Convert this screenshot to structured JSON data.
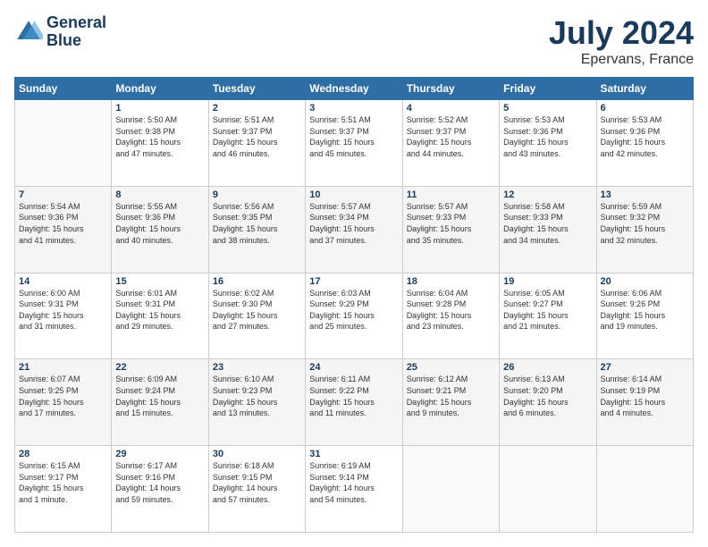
{
  "logo": {
    "line1": "General",
    "line2": "Blue"
  },
  "title": "July 2024",
  "subtitle": "Epervans, France",
  "header_days": [
    "Sunday",
    "Monday",
    "Tuesday",
    "Wednesday",
    "Thursday",
    "Friday",
    "Saturday"
  ],
  "weeks": [
    [
      {
        "day": "",
        "info": ""
      },
      {
        "day": "1",
        "info": "Sunrise: 5:50 AM\nSunset: 9:38 PM\nDaylight: 15 hours\nand 47 minutes."
      },
      {
        "day": "2",
        "info": "Sunrise: 5:51 AM\nSunset: 9:37 PM\nDaylight: 15 hours\nand 46 minutes."
      },
      {
        "day": "3",
        "info": "Sunrise: 5:51 AM\nSunset: 9:37 PM\nDaylight: 15 hours\nand 45 minutes."
      },
      {
        "day": "4",
        "info": "Sunrise: 5:52 AM\nSunset: 9:37 PM\nDaylight: 15 hours\nand 44 minutes."
      },
      {
        "day": "5",
        "info": "Sunrise: 5:53 AM\nSunset: 9:36 PM\nDaylight: 15 hours\nand 43 minutes."
      },
      {
        "day": "6",
        "info": "Sunrise: 5:53 AM\nSunset: 9:36 PM\nDaylight: 15 hours\nand 42 minutes."
      }
    ],
    [
      {
        "day": "7",
        "info": "Sunrise: 5:54 AM\nSunset: 9:36 PM\nDaylight: 15 hours\nand 41 minutes."
      },
      {
        "day": "8",
        "info": "Sunrise: 5:55 AM\nSunset: 9:36 PM\nDaylight: 15 hours\nand 40 minutes."
      },
      {
        "day": "9",
        "info": "Sunrise: 5:56 AM\nSunset: 9:35 PM\nDaylight: 15 hours\nand 38 minutes."
      },
      {
        "day": "10",
        "info": "Sunrise: 5:57 AM\nSunset: 9:34 PM\nDaylight: 15 hours\nand 37 minutes."
      },
      {
        "day": "11",
        "info": "Sunrise: 5:57 AM\nSunset: 9:33 PM\nDaylight: 15 hours\nand 35 minutes."
      },
      {
        "day": "12",
        "info": "Sunrise: 5:58 AM\nSunset: 9:33 PM\nDaylight: 15 hours\nand 34 minutes."
      },
      {
        "day": "13",
        "info": "Sunrise: 5:59 AM\nSunset: 9:32 PM\nDaylight: 15 hours\nand 32 minutes."
      }
    ],
    [
      {
        "day": "14",
        "info": "Sunrise: 6:00 AM\nSunset: 9:31 PM\nDaylight: 15 hours\nand 31 minutes."
      },
      {
        "day": "15",
        "info": "Sunrise: 6:01 AM\nSunset: 9:31 PM\nDaylight: 15 hours\nand 29 minutes."
      },
      {
        "day": "16",
        "info": "Sunrise: 6:02 AM\nSunset: 9:30 PM\nDaylight: 15 hours\nand 27 minutes."
      },
      {
        "day": "17",
        "info": "Sunrise: 6:03 AM\nSunset: 9:29 PM\nDaylight: 15 hours\nand 25 minutes."
      },
      {
        "day": "18",
        "info": "Sunrise: 6:04 AM\nSunset: 9:28 PM\nDaylight: 15 hours\nand 23 minutes."
      },
      {
        "day": "19",
        "info": "Sunrise: 6:05 AM\nSunset: 9:27 PM\nDaylight: 15 hours\nand 21 minutes."
      },
      {
        "day": "20",
        "info": "Sunrise: 6:06 AM\nSunset: 9:26 PM\nDaylight: 15 hours\nand 19 minutes."
      }
    ],
    [
      {
        "day": "21",
        "info": "Sunrise: 6:07 AM\nSunset: 9:25 PM\nDaylight: 15 hours\nand 17 minutes."
      },
      {
        "day": "22",
        "info": "Sunrise: 6:09 AM\nSunset: 9:24 PM\nDaylight: 15 hours\nand 15 minutes."
      },
      {
        "day": "23",
        "info": "Sunrise: 6:10 AM\nSunset: 9:23 PM\nDaylight: 15 hours\nand 13 minutes."
      },
      {
        "day": "24",
        "info": "Sunrise: 6:11 AM\nSunset: 9:22 PM\nDaylight: 15 hours\nand 11 minutes."
      },
      {
        "day": "25",
        "info": "Sunrise: 6:12 AM\nSunset: 9:21 PM\nDaylight: 15 hours\nand 9 minutes."
      },
      {
        "day": "26",
        "info": "Sunrise: 6:13 AM\nSunset: 9:20 PM\nDaylight: 15 hours\nand 6 minutes."
      },
      {
        "day": "27",
        "info": "Sunrise: 6:14 AM\nSunset: 9:19 PM\nDaylight: 15 hours\nand 4 minutes."
      }
    ],
    [
      {
        "day": "28",
        "info": "Sunrise: 6:15 AM\nSunset: 9:17 PM\nDaylight: 15 hours\nand 1 minute."
      },
      {
        "day": "29",
        "info": "Sunrise: 6:17 AM\nSunset: 9:16 PM\nDaylight: 14 hours\nand 59 minutes."
      },
      {
        "day": "30",
        "info": "Sunrise: 6:18 AM\nSunset: 9:15 PM\nDaylight: 14 hours\nand 57 minutes."
      },
      {
        "day": "31",
        "info": "Sunrise: 6:19 AM\nSunset: 9:14 PM\nDaylight: 14 hours\nand 54 minutes."
      },
      {
        "day": "",
        "info": ""
      },
      {
        "day": "",
        "info": ""
      },
      {
        "day": "",
        "info": ""
      }
    ]
  ]
}
